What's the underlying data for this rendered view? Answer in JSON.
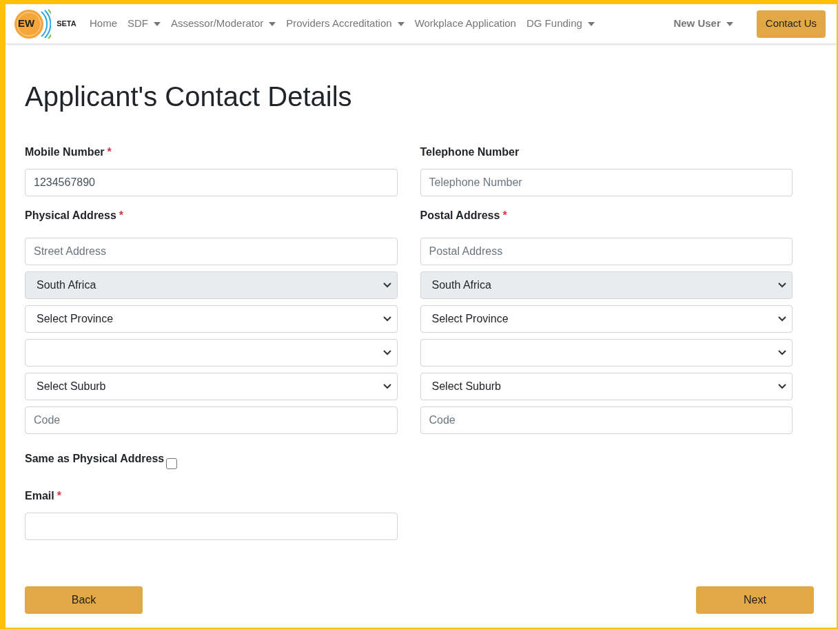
{
  "nav": {
    "logo": {
      "left": "EW",
      "right": "SETA"
    },
    "items": [
      {
        "label": "Home",
        "dropdown": false
      },
      {
        "label": "SDF",
        "dropdown": true
      },
      {
        "label": "Assessor/Moderator",
        "dropdown": true
      },
      {
        "label": "Providers Accreditation",
        "dropdown": true
      },
      {
        "label": "Workplace Application",
        "dropdown": false
      },
      {
        "label": "DG Funding",
        "dropdown": true
      }
    ],
    "user": {
      "label": "New User",
      "dropdown": true
    },
    "contact_button": "Contact Us"
  },
  "title": "Applicant's Contact Details",
  "rows": [
    [
      {
        "label": "Mobile Number",
        "required_mark": "*",
        "fields": [
          {
            "kind": "input",
            "value": "1234567890"
          }
        ]
      },
      {
        "label": "Telephone Number",
        "fields": [
          {
            "kind": "input",
            "placeholder": "Telephone Number"
          }
        ]
      }
    ],
    [
      {
        "label": "Physical Address",
        "required_mark": "*",
        "fields": [
          {
            "kind": "input",
            "placeholder": "Street Address"
          },
          {
            "kind": "select",
            "value": "South Africa",
            "disabled": true
          },
          {
            "kind": "select",
            "value": "Select Province",
            "disabled": false
          },
          {
            "kind": "select",
            "disabled": false
          },
          {
            "kind": "select",
            "value": "Select Suburb",
            "disabled": false
          },
          {
            "kind": "input",
            "placeholder": "Code"
          }
        ]
      },
      {
        "label": "Postal Address",
        "required_mark": "*",
        "fields": [
          {
            "kind": "input",
            "placeholder": "Postal Address"
          },
          {
            "kind": "select",
            "value": "South Africa",
            "disabled": true
          },
          {
            "kind": "select",
            "value": "Select Province",
            "disabled": false
          },
          {
            "kind": "select",
            "disabled": false
          },
          {
            "kind": "select",
            "value": "Select Suburb",
            "disabled": false
          },
          {
            "kind": "input",
            "placeholder": "Code"
          }
        ]
      }
    ]
  ],
  "same_as_physical": {
    "label": "Same as Physical Address",
    "checked": false
  },
  "email": {
    "label": "Email",
    "required_mark": "*"
  },
  "buttons": {
    "back": "Back",
    "next": "Next"
  }
}
